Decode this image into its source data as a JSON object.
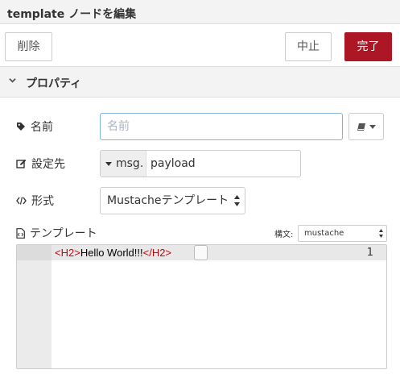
{
  "dialog": {
    "title": "template ノードを編集"
  },
  "toolbar": {
    "delete_label": "削除",
    "cancel_label": "中止",
    "done_label": "完了",
    "accent_color": "#ad1625"
  },
  "section": {
    "label": "プロパティ",
    "icon": "chevron-down-icon"
  },
  "form": {
    "name": {
      "label": "名前",
      "icon": "tag-icon",
      "value": "",
      "placeholder": "名前",
      "side_button_icon": "book-icon"
    },
    "property": {
      "label": "設定先",
      "icon": "edit-icon",
      "type_prefix": "msg.",
      "value": "payload"
    },
    "format": {
      "label": "形式",
      "icon": "code-icon",
      "selected": "Mustacheテンプレート"
    },
    "template": {
      "label": "テンプレート",
      "icon": "file-code-icon",
      "syntax_label": "構文:",
      "syntax_selected": "mustache"
    }
  },
  "editor": {
    "line_numbers": [
      "1"
    ],
    "code": {
      "open_tag": "<H2>",
      "text": "Hello World!!!",
      "close_tag": "</H2>"
    }
  }
}
